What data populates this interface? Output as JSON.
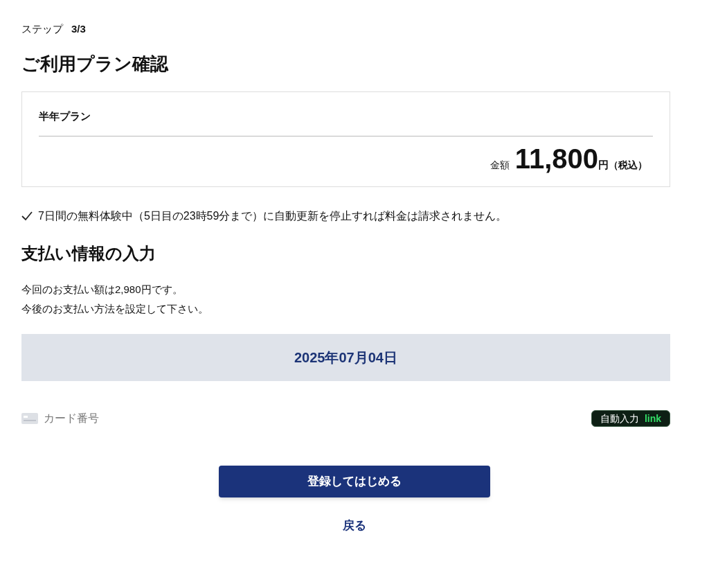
{
  "step": {
    "label": "ステップ",
    "value": "3/3"
  },
  "title": "ご利用プラン確認",
  "plan": {
    "name": "半年プラン",
    "price_label": "金額",
    "price": "11,800",
    "unit": "円",
    "tax": "（税込）"
  },
  "notice": "7日間の無料体験中（5日目の23時59分まで）に自動更新を停止すれば料金は請求されません。",
  "payment": {
    "heading": "支払い情報の入力",
    "lines": [
      "今回のお支払い額は2,980円です。",
      "今後のお支払い方法を設定して下さい。"
    ],
    "date": "2025年07月04日",
    "card_field": {
      "placeholder": "カード番号"
    },
    "autofill": {
      "label": "自動入力",
      "brand": "link"
    }
  },
  "submit": "登録してはじめる",
  "back": "戻る"
}
